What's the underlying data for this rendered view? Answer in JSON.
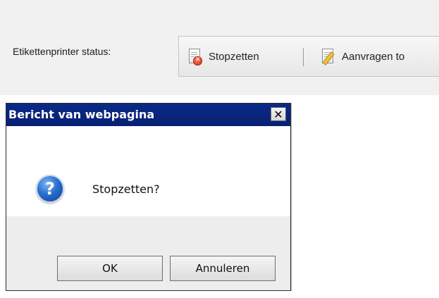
{
  "header": {
    "status_label": "Etikettenprinter status:",
    "stop_label": "Stopzetten",
    "request_label": "Aanvragen to"
  },
  "dialog": {
    "title": "Bericht van webpagina",
    "message": "Stopzetten?",
    "ok_label": "OK",
    "cancel_label": "Annuleren",
    "close_glyph": "✕",
    "icon": "question-icon"
  },
  "colors": {
    "title_bar": "#0b2a86",
    "toolbar_bg": "#eeeeee",
    "page_bg": "#f1f1f1"
  }
}
